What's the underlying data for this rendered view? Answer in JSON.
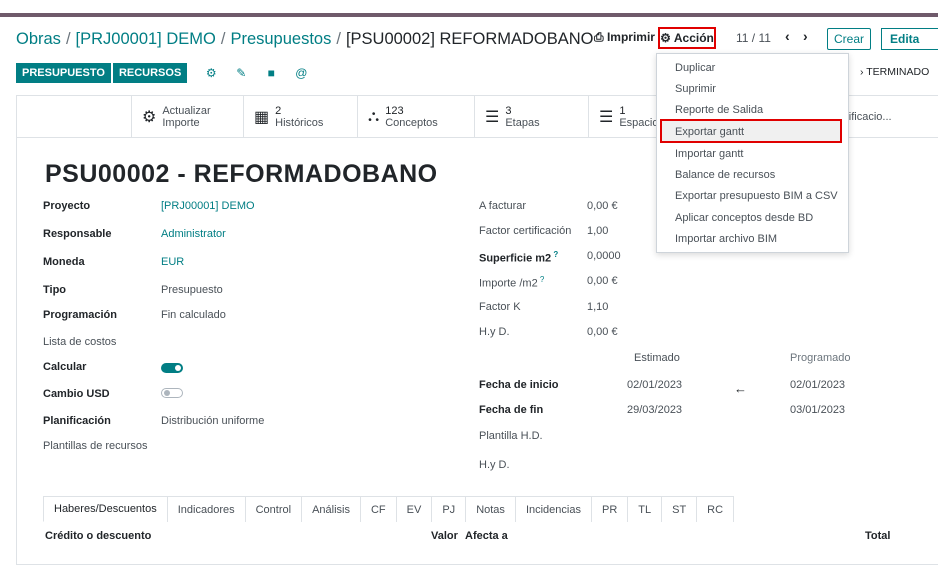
{
  "breadcrumb": [
    "Obras",
    "[PRJ00001] DEMO",
    "Presupuestos",
    "[PSU00002] REFORMADOBANO"
  ],
  "header": {
    "print_label": "Imprimir",
    "action_label": "Acción",
    "pager": "11 / 11",
    "create_label": "Crear",
    "edit_label": "Edita"
  },
  "toolbar": {
    "presupuesto_label": "PRESUPUESTO",
    "recursos_label": "RECURSOS",
    "status_label": "TERMINADO"
  },
  "stats": [
    {
      "num": "",
      "label_top": "Actualizar",
      "label_bottom": "Importe"
    },
    {
      "num": "2",
      "label_bottom": "Históricos"
    },
    {
      "num": "123",
      "label_bottom": "Conceptos"
    },
    {
      "num": "3",
      "label_bottom": "Etapas"
    },
    {
      "num": "1",
      "label_bottom": "Espacios"
    },
    {
      "num": "",
      "label_bottom": "Certificacio..."
    }
  ],
  "record": {
    "title": "PSU00002 - REFORMADOBANO",
    "left": [
      {
        "label": "Proyecto",
        "value": "[PRJ00001] DEMO"
      },
      {
        "label": "Responsable",
        "value": "Administrator"
      },
      {
        "label": "Moneda",
        "value": "EUR"
      },
      {
        "label": "Tipo",
        "value": "Presupuesto"
      },
      {
        "label": "Programación",
        "value": "Fin calculado"
      },
      {
        "label": "Lista de costos",
        "value": ""
      },
      {
        "label": "Calcular",
        "value": ""
      },
      {
        "label": "Cambio USD",
        "value": ""
      },
      {
        "label": "Planificación",
        "value": "Distribución uniforme"
      },
      {
        "label": "Plantillas de recursos",
        "value": ""
      }
    ],
    "right": [
      {
        "label": "A facturar",
        "value": "0,00 €"
      },
      {
        "label": "Factor certificación",
        "value": "1,00"
      },
      {
        "label": "Superficie m2",
        "value": "0,0000"
      },
      {
        "label": "Importe /m2",
        "value": "0,00 €"
      },
      {
        "label": "Factor K",
        "value": "1,10"
      },
      {
        "label": "H.y D.",
        "value": "0,00 €"
      }
    ],
    "estimated_header": "Estimado",
    "programmed_header": "Programado",
    "dates": [
      {
        "label": "Fecha de inicio",
        "estimated": "02/01/2023",
        "programmed": "02/01/2023"
      },
      {
        "label": "Fecha de fin",
        "estimated": "29/03/2023",
        "programmed": "03/01/2023"
      }
    ],
    "plantilla_hd": "Plantilla H.D.",
    "hyd2": "H.y D."
  },
  "tabs": [
    "Haberes/Descuentos",
    "Indicadores",
    "Control",
    "Análisis",
    "CF",
    "EV",
    "PJ",
    "Notas",
    "Incidencias",
    "PR",
    "TL",
    "ST",
    "RC"
  ],
  "table": {
    "col1": "Crédito o descuento",
    "col2": "Valor",
    "col3": "Afecta a",
    "col4": "Total"
  },
  "action_menu": [
    "Duplicar",
    "Suprimir",
    "Reporte de Salida",
    "Exportar gantt",
    "Importar gantt",
    "Balance de recursos",
    "Exportar presupuesto BIM a CSV",
    "Aplicar conceptos desde BD",
    "Importar archivo BIM"
  ],
  "colors": {
    "primary": "#017e84",
    "highlight_border": "#e00000",
    "topbar": "#6f5a6b"
  }
}
